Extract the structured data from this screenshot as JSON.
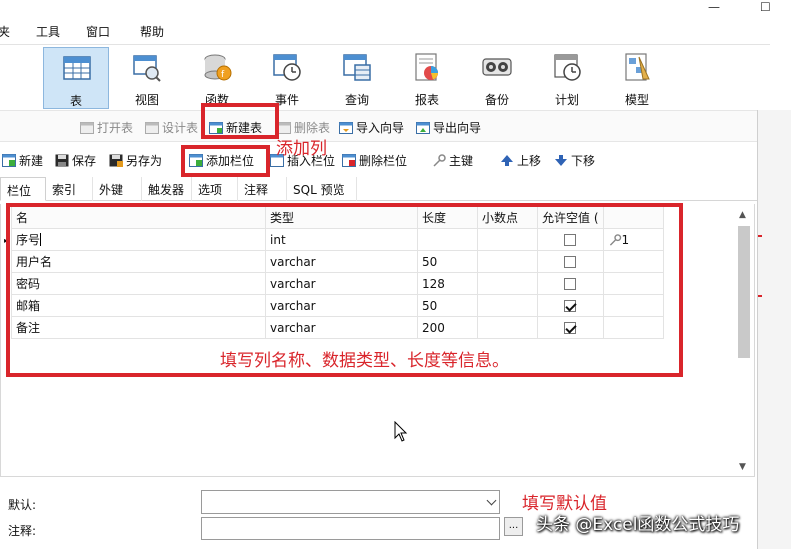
{
  "window": {
    "minimize": "—",
    "maximize": "☐"
  },
  "menu": {
    "items": [
      "夹",
      "工具",
      "窗口",
      "帮助"
    ]
  },
  "big_toolbar": {
    "items": [
      {
        "label": "表",
        "icon": "table-icon",
        "active": true
      },
      {
        "label": "视图",
        "icon": "view-icon"
      },
      {
        "label": "函数",
        "icon": "function-icon"
      },
      {
        "label": "事件",
        "icon": "event-icon"
      },
      {
        "label": "查询",
        "icon": "query-icon"
      },
      {
        "label": "报表",
        "icon": "report-icon"
      },
      {
        "label": "备份",
        "icon": "backup-icon"
      },
      {
        "label": "计划",
        "icon": "schedule-icon"
      },
      {
        "label": "模型",
        "icon": "model-icon"
      }
    ]
  },
  "sub_toolbar": {
    "items": [
      {
        "label": "打开表",
        "disabled": true
      },
      {
        "label": "设计表",
        "disabled": true
      },
      {
        "label": "新建表",
        "disabled": false
      },
      {
        "label": "删除表",
        "disabled": true
      },
      {
        "label": "导入向导",
        "disabled": false
      },
      {
        "label": "导出向导",
        "disabled": false
      }
    ]
  },
  "editor_toolbar": {
    "items": [
      "新建",
      "保存",
      "另存为",
      "添加栏位",
      "插入栏位",
      "删除栏位",
      "主键",
      "上移",
      "下移"
    ]
  },
  "tabs": [
    "栏位",
    "索引",
    "外键",
    "触发器",
    "选项",
    "注释",
    "SQL 预览"
  ],
  "grid": {
    "headers": [
      "名",
      "类型",
      "长度",
      "小数点",
      "允许空值 (",
      ""
    ],
    "rows": [
      {
        "name": "序号",
        "type": "int",
        "length": "",
        "decimals": "",
        "nullable": false,
        "key": "1"
      },
      {
        "name": "用户名",
        "type": "varchar",
        "length": "50",
        "decimals": "",
        "nullable": false,
        "key": ""
      },
      {
        "name": "密码",
        "type": "varchar",
        "length": "128",
        "decimals": "",
        "nullable": false,
        "key": ""
      },
      {
        "name": "邮箱",
        "type": "varchar",
        "length": "50",
        "decimals": "",
        "nullable": true,
        "key": ""
      },
      {
        "name": "备注",
        "type": "varchar",
        "length": "200",
        "decimals": "",
        "nullable": true,
        "key": ""
      }
    ]
  },
  "annotations": {
    "add_column": "添加列",
    "fill_info": "填写列名称、数据类型、长度等信息。",
    "fill_default": "填写默认值"
  },
  "form": {
    "default_label": "默认:",
    "comment_label": "注释:",
    "default_value": "",
    "comment_value": "",
    "ellipsis": "..."
  },
  "watermark": "头条 @Excel函数公式技巧",
  "colors": {
    "annotation_red": "#d9252b",
    "active_tab_bg": "#cfe5f7"
  }
}
